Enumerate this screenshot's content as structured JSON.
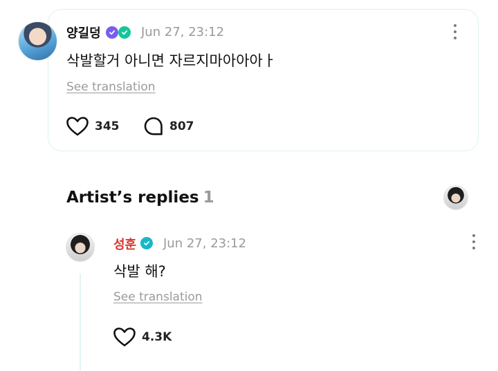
{
  "post": {
    "author": "양길덩",
    "timestamp": "Jun 27, 23:12",
    "body": "삭발할거 아니면 자르지마아아아ㅏ",
    "see_translation": "See translation",
    "likes": "345",
    "comments": "807",
    "badges": [
      "purple-shield-check-icon",
      "green-heart-check-icon"
    ]
  },
  "artist_replies": {
    "title": "Artist’s replies",
    "count": "1"
  },
  "reply": {
    "author": "성훈",
    "timestamp": "Jun 27, 23:12",
    "body": "삭발 해?",
    "see_translation": "See translation",
    "likes": "4.3K",
    "author_color": "#d9332b",
    "badge": "verified-check-icon"
  },
  "colors": {
    "card_border": "#dff1f1",
    "muted_text": "#9a9a9a",
    "thread_line": "#e2f3f3"
  }
}
